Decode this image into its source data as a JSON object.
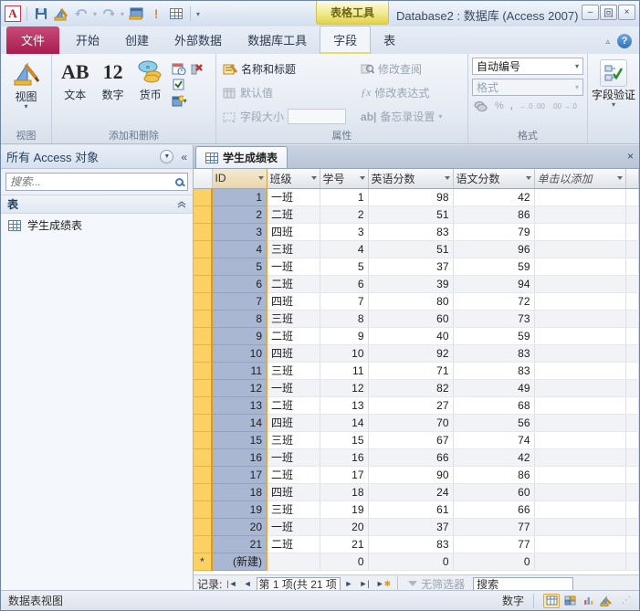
{
  "window": {
    "title": "Database2 : 数据库 (Access 2007)",
    "contextual_tool": "表格工具",
    "min": "–",
    "max": "回",
    "close": "×"
  },
  "qat": {
    "logo": "A",
    "dropdown": "▾"
  },
  "tabs": {
    "file": "文件",
    "home": "开始",
    "create": "创建",
    "external": "外部数据",
    "dbtools": "数据库工具",
    "fields": "字段",
    "table": "表"
  },
  "ribbon": {
    "view_group": {
      "button": "视图",
      "label": "视图"
    },
    "add_delete": {
      "ab": "AB",
      "text": "文本",
      "twelve": "12",
      "number": "数字",
      "currency": "货币",
      "label": "添加和删除"
    },
    "properties": {
      "name_caption": "名称和标题",
      "default_value": "默认值",
      "field_size": "字段大小",
      "modify_lookup": "修改查阅",
      "fx": "ƒx",
      "modify_expr": "修改表达式",
      "ab_mark": "ab|",
      "memo_settings": "备忘录设置",
      "label": "属性"
    },
    "format": {
      "datatype": "自动编号",
      "format_placeholder": "格式",
      "percent": "%",
      "comma": ",",
      "inc": "←.0 .00",
      "dec": ".00 →.0",
      "label": "格式"
    },
    "validation": {
      "button": "字段验证",
      "dropdown": "▾"
    }
  },
  "nav_pane": {
    "title": "所有 Access 对象",
    "collapse": "«",
    "search_placeholder": "搜索...",
    "section": "表",
    "item": "学生成绩表"
  },
  "document": {
    "tab": "学生成绩表",
    "close": "×"
  },
  "table": {
    "columns": [
      "ID",
      "班级",
      "学号",
      "英语分数",
      "语文分数",
      "单击以添加"
    ],
    "rows": [
      [
        1,
        "一班",
        1,
        98,
        42
      ],
      [
        2,
        "二班",
        2,
        51,
        86
      ],
      [
        3,
        "四班",
        3,
        83,
        79
      ],
      [
        4,
        "三班",
        4,
        51,
        96
      ],
      [
        5,
        "一班",
        5,
        37,
        59
      ],
      [
        6,
        "二班",
        6,
        39,
        94
      ],
      [
        7,
        "四班",
        7,
        80,
        72
      ],
      [
        8,
        "三班",
        8,
        60,
        73
      ],
      [
        9,
        "二班",
        9,
        40,
        59
      ],
      [
        10,
        "四班",
        10,
        92,
        83
      ],
      [
        11,
        "三班",
        11,
        71,
        83
      ],
      [
        12,
        "一班",
        12,
        82,
        49
      ],
      [
        13,
        "二班",
        13,
        27,
        68
      ],
      [
        14,
        "四班",
        14,
        70,
        56
      ],
      [
        15,
        "三班",
        15,
        67,
        74
      ],
      [
        16,
        "一班",
        16,
        66,
        42
      ],
      [
        17,
        "二班",
        17,
        90,
        86
      ],
      [
        18,
        "四班",
        18,
        24,
        60
      ],
      [
        19,
        "三班",
        19,
        61,
        66
      ],
      [
        20,
        "一班",
        20,
        37,
        77
      ],
      [
        21,
        "二班",
        21,
        83,
        77
      ]
    ],
    "new_row": {
      "selector": "*",
      "id_label": "(新建)",
      "values": [
        "",
        0,
        0,
        0
      ]
    }
  },
  "record_nav": {
    "label": "记录:",
    "first": "◄",
    "prev": "◄",
    "position": "第 1 项(共 21 项",
    "next": "►",
    "last": "►",
    "new": "►",
    "no_filter": "无筛选器",
    "search_value": "搜索"
  },
  "status_bar": {
    "left": "数据表视图",
    "numlock": "数字"
  }
}
